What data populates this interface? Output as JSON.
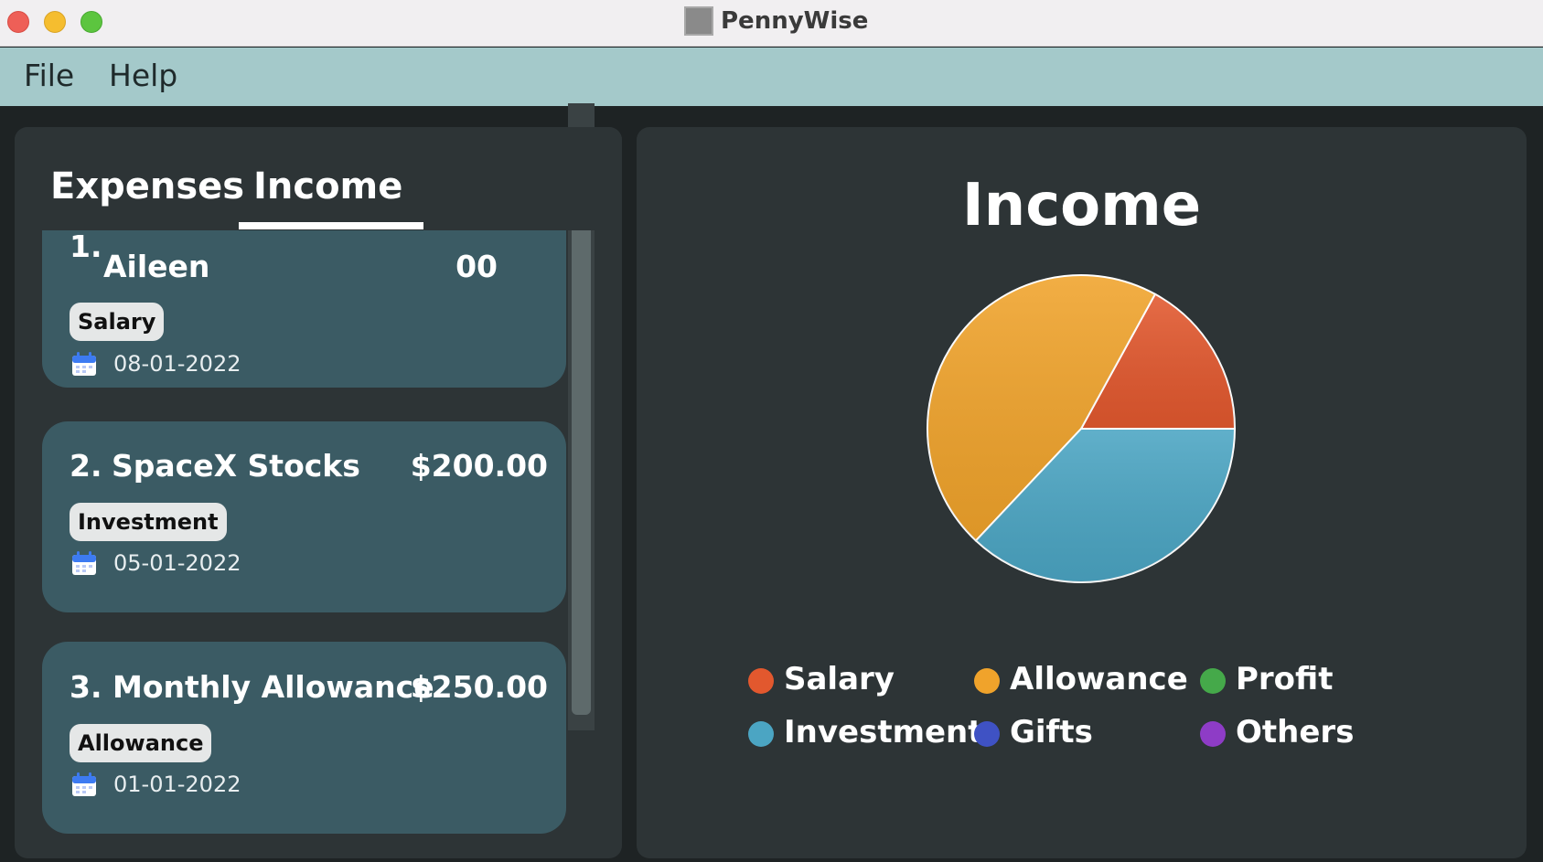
{
  "window": {
    "title": "PennyWise"
  },
  "menu": {
    "file": "File",
    "help": "Help"
  },
  "tabs": {
    "expenses": "Expenses",
    "income": "Income",
    "selected": "Income"
  },
  "entries": [
    {
      "index": "1.",
      "title": "Aileen",
      "amount": "00",
      "tag": "Salary",
      "date": "08-01-2022"
    },
    {
      "index": "2.",
      "title": "SpaceX Stocks",
      "amount": "$200.00",
      "tag": "Investment",
      "date": "05-01-2022"
    },
    {
      "index": "3.",
      "title": "Monthly Allowance",
      "amount": "$250.00",
      "tag": "Allowance",
      "date": "01-01-2022"
    }
  ],
  "chart_data": {
    "type": "pie",
    "title": "Income",
    "slices": [
      {
        "name": "Salary",
        "value": 17,
        "color": "#e2582e"
      },
      {
        "name": "Allowance",
        "value": 46,
        "color": "#f0a32b"
      },
      {
        "name": "Investment",
        "value": 37,
        "color": "#4ba5c3"
      },
      {
        "name": "Gifts",
        "value": 0,
        "color": "#3f52c4"
      },
      {
        "name": "Profit",
        "value": 0,
        "color": "#45a94a"
      },
      {
        "name": "Others",
        "value": 0,
        "color": "#8e3cc6"
      }
    ],
    "legend": [
      "Salary",
      "Allowance",
      "Profit",
      "Investment",
      "Gifts",
      "Others"
    ],
    "legend_position": "bottom"
  }
}
